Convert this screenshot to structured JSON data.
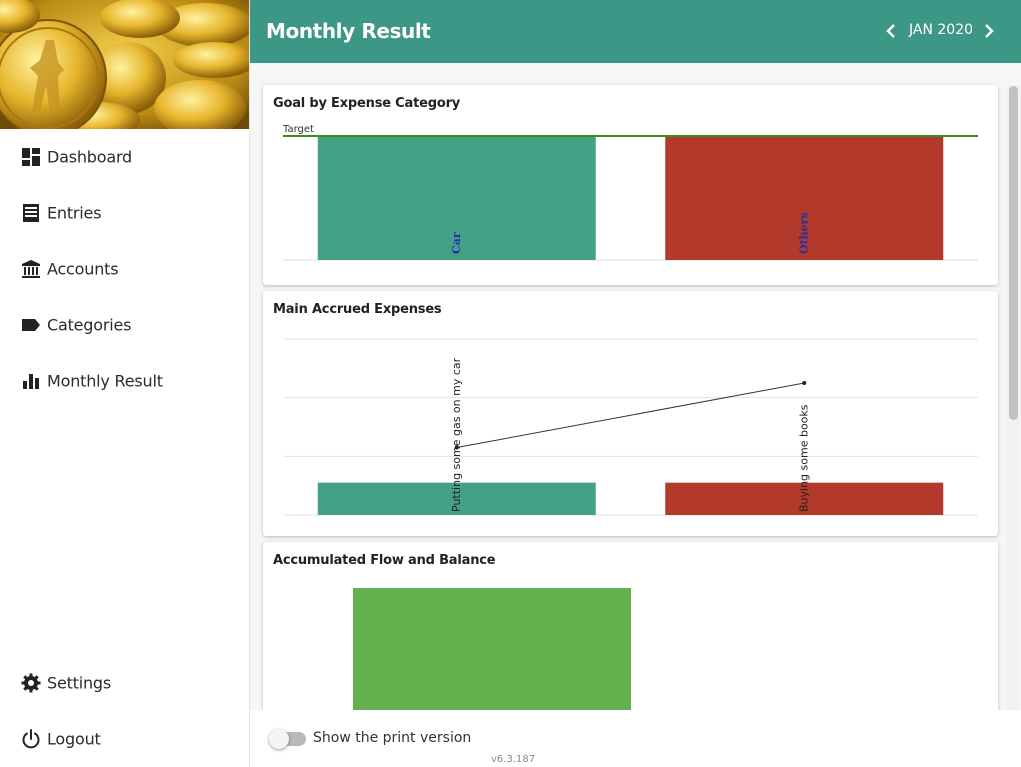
{
  "header": {
    "title": "Monthly Result",
    "month": "JAN 2020",
    "prev_icon": "chevron-left-icon",
    "next_icon": "chevron-right-icon",
    "color": "#3d9786"
  },
  "sidebar": {
    "items": [
      {
        "label": "Dashboard",
        "icon": "dashboard-icon"
      },
      {
        "label": "Entries",
        "icon": "receipt-icon"
      },
      {
        "label": "Accounts",
        "icon": "bank-icon"
      },
      {
        "label": "Categories",
        "icon": "label-icon"
      },
      {
        "label": "Monthly Result",
        "icon": "bar-chart-icon"
      }
    ],
    "bottom_items": [
      {
        "label": "Settings",
        "icon": "gear-icon"
      },
      {
        "label": "Logout",
        "icon": "power-icon"
      }
    ]
  },
  "cards": {
    "goal": {
      "title": "Goal by Expense Category"
    },
    "accrued": {
      "title": "Main Accrued Expenses"
    },
    "accumulated": {
      "title": "Accumulated Flow and Balance"
    }
  },
  "footer": {
    "print_label": "Show the print version",
    "print_enabled": false,
    "version": "v6.3.187"
  },
  "chart_data": [
    {
      "type": "bar",
      "title": "Goal by Expense Category",
      "categories": [
        "Car",
        "Others"
      ],
      "values": [
        100,
        100
      ],
      "colors": [
        "#43a186",
        "#b33a2a"
      ],
      "target_label": "Target",
      "target": 100,
      "ylim": [
        0,
        100
      ]
    },
    {
      "type": "bar",
      "title": "Main Accrued Expenses",
      "categories": [
        "Putting some gas on my car",
        "Buying some books"
      ],
      "values": [
        1,
        1
      ],
      "line_values": [
        2.3,
        4.5
      ],
      "colors": [
        "#43a186",
        "#b33a2a"
      ],
      "ylim": [
        0,
        6
      ]
    },
    {
      "type": "bar",
      "title": "Accumulated Flow and Balance",
      "values": [
        1
      ],
      "colors": [
        "#62b04e"
      ]
    }
  ]
}
